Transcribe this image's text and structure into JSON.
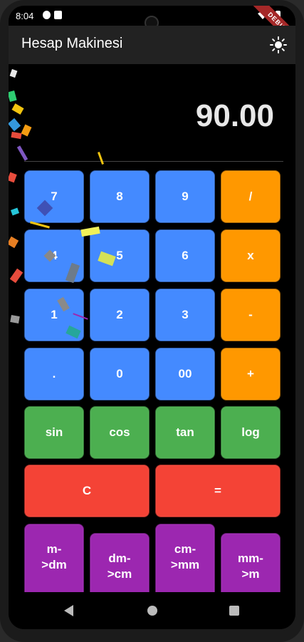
{
  "status_bar": {
    "time": "8:04"
  },
  "debug_banner": "DEBUG",
  "app_bar": {
    "title": "Hesap Makinesi",
    "theme_icon": "sun-icon"
  },
  "display": {
    "value": "90.00"
  },
  "keys": {
    "k7": "7",
    "k8": "8",
    "k9": "9",
    "div": "/",
    "k4": "4",
    "k5": "5",
    "k6": "6",
    "mul": "x",
    "k1": "1",
    "k2": "2",
    "k3": "3",
    "sub": "-",
    "dot": ".",
    "k0": "0",
    "k00": "00",
    "add": "+",
    "sin": "sin",
    "cos": "cos",
    "tan": "tan",
    "log": "log",
    "clear": "C",
    "equals": "=",
    "m_dm": "m->dm",
    "dm_cm": "dm->cm",
    "cm_mm": "cm->mm",
    "mm_m": "mm->m"
  },
  "colors": {
    "number_key": "#448aff",
    "operator_key": "#ff9800",
    "function_key": "#4caf50",
    "action_key": "#f44336",
    "conversion_key": "#9c27b0"
  }
}
